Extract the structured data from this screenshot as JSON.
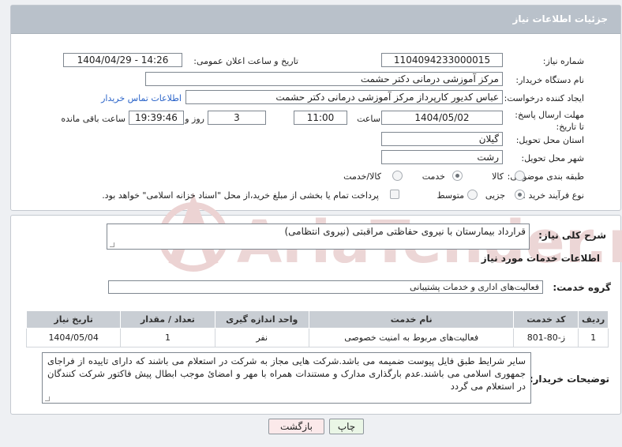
{
  "header": {
    "title": "جزئیات اطلاعات نیاز"
  },
  "need_number": {
    "label": "شماره نیاز:",
    "value": "1104094233000015"
  },
  "announce_datetime": {
    "label": "تاریخ و ساعت اعلان عمومی:",
    "value": "1404/04/29 - 14:26"
  },
  "buyer_org": {
    "label": "نام دستگاه خریدار:",
    "value": "مرکز آموزشی درمانی دکتر حشمت"
  },
  "creator": {
    "label": "ایجاد کننده درخواست:",
    "value": "عباس کدیور کارپرداز مرکز آموزشی درمانی دکتر حشمت",
    "contact_link": "اطلاعات تماس خریدار"
  },
  "deadline": {
    "label": "مهلت ارسال پاسخ: تا تاریخ:",
    "date": "1404/05/02",
    "time_label": "ساعت",
    "time": "11:00",
    "days": "3",
    "days_label": "روز و",
    "remaining": "19:39:46",
    "remaining_label": "ساعت باقی مانده"
  },
  "province": {
    "label": "استان محل تحویل:",
    "value": "گیلان"
  },
  "city": {
    "label": "شهر محل تحویل:",
    "value": "رشت"
  },
  "category": {
    "label": "طبقه بندی موضوعی:",
    "options": [
      "کالا",
      "خدمت",
      "کالا/خدمت"
    ],
    "selected": "خدمت"
  },
  "process": {
    "label": "نوع فرآیند خرید :",
    "options": [
      "جزیی",
      "متوسط"
    ],
    "selected": "جزیی",
    "payment_note": "پرداخت تمام یا بخشی از مبلغ خرید،از محل \"اسناد خزانه اسلامی\" خواهد بود."
  },
  "summary": {
    "label": "شرح کلی نیاز:",
    "value": "قرارداد بیمارستان با نیروی حفاظتی مراقبتی (نیروی انتظامی)"
  },
  "services": {
    "section_title": "اطلاعات خدمات مورد نیاز",
    "group_label": "گروه خدمت:",
    "group_value": "فعالیت‌های اداری و خدمات پشتیبانی",
    "columns": [
      "ردیف",
      "کد خدمت",
      "نام خدمت",
      "واحد اندازه گیری",
      "تعداد / مقدار",
      "تاریخ نیاز"
    ],
    "rows": [
      [
        "1",
        "ز-80-801",
        "فعالیت‌های مربوط به امنیت خصوصی",
        "نفر",
        "1",
        "1404/05/04"
      ]
    ]
  },
  "buyer_notes": {
    "label": "توضیحات خریدار:",
    "value": "سایر شرایط طبق فایل پیوست ضمیمه می باشد.شرکت هایی مجاز به شرکت در استعلام می باشند که دارای تاییده از فراجای جمهوری اسلامی می باشند.عدم بارگذاری مدارک و مستندات همراه با مهر و امضائ موجب ابطال پیش فاکتور شرکت کنندگان در استعلام می گردد"
  },
  "buttons": {
    "print": "چاپ",
    "back": "بازگشت"
  },
  "watermark": {
    "text": "AriaTender.net",
    "color": "#e9c9c9"
  }
}
